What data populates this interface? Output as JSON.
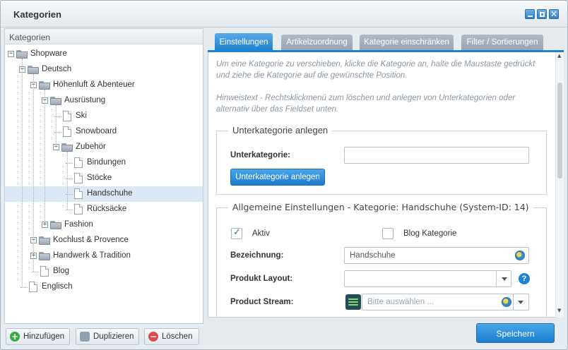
{
  "window": {
    "title": "Kategorien"
  },
  "tree": {
    "header": "Kategorien",
    "nodes": [
      {
        "label": "Shopware",
        "depth": 0,
        "type": "folder",
        "expanded": true
      },
      {
        "label": "Deutsch",
        "depth": 1,
        "type": "folder",
        "expanded": true
      },
      {
        "label": "Höhenluft & Abenteuer",
        "depth": 2,
        "type": "folder",
        "expanded": true
      },
      {
        "label": "Ausrüstung",
        "depth": 3,
        "type": "folder",
        "expanded": true
      },
      {
        "label": "Ski",
        "depth": 4,
        "type": "leaf"
      },
      {
        "label": "Snowboard",
        "depth": 4,
        "type": "leaf"
      },
      {
        "label": "Zubehör",
        "depth": 4,
        "type": "folder",
        "expanded": true
      },
      {
        "label": "Bindungen",
        "depth": 5,
        "type": "leaf"
      },
      {
        "label": "Stöcke",
        "depth": 5,
        "type": "leaf"
      },
      {
        "label": "Handschuhe",
        "depth": 5,
        "type": "leaf",
        "selected": true
      },
      {
        "label": "Rücksäcke",
        "depth": 5,
        "type": "leaf"
      },
      {
        "label": "Fashion",
        "depth": 3,
        "type": "folder",
        "expanded": false
      },
      {
        "label": "Kochlust & Provence",
        "depth": 2,
        "type": "folder",
        "expanded": true
      },
      {
        "label": "Handwerk & Tradition",
        "depth": 2,
        "type": "folder",
        "expanded": false
      },
      {
        "label": "Blog",
        "depth": 2,
        "type": "leaf"
      },
      {
        "label": "Englisch",
        "depth": 1,
        "type": "leaf"
      }
    ]
  },
  "left_buttons": {
    "add": "Hinzufügen",
    "duplicate": "Duplizieren",
    "delete": "Löschen"
  },
  "tabs": [
    {
      "label": "Einstellungen",
      "active": true
    },
    {
      "label": "Artikelzuordnung",
      "active": false
    },
    {
      "label": "Kategorie einschränken",
      "active": false
    },
    {
      "label": "Filter / Sortierungen",
      "active": false
    }
  ],
  "hints": {
    "move": "Um eine Kategorie zu verschieben, klicke die Kategorie an, halte die Maustaste gedrückt und ziehe die Kategorie auf die gewünschte Position.",
    "context": "Hinweistext - Rechtsklickmenü zum löschen und anlegen von Unterkategorien oder alternativ über das Fieldset unten."
  },
  "subcategory": {
    "legend": "Unterkategorie anlegen",
    "field_label": "Unterkategorie:",
    "value": "",
    "button": "Unterkategorie anlegen"
  },
  "general": {
    "legend": "Allgemeine Einstellungen - Kategorie: Handschuhe (System-ID: 14)",
    "active_label": "Aktiv",
    "active_checked": true,
    "blog_label": "Blog Kategorie",
    "blog_checked": false,
    "name_label": "Bezeichnung:",
    "name_value": "Handschuhe",
    "layout_label": "Produkt Layout:",
    "layout_value": "",
    "stream_label": "Product Stream:",
    "stream_placeholder": "Bitte auswählen ..."
  },
  "footer": {
    "save": "Speichern"
  },
  "icons": {
    "tree_expanded": "−",
    "tree_collapsed": "+",
    "add": "+",
    "delete": "−",
    "help": "?",
    "check": "✓",
    "close": "✕"
  }
}
